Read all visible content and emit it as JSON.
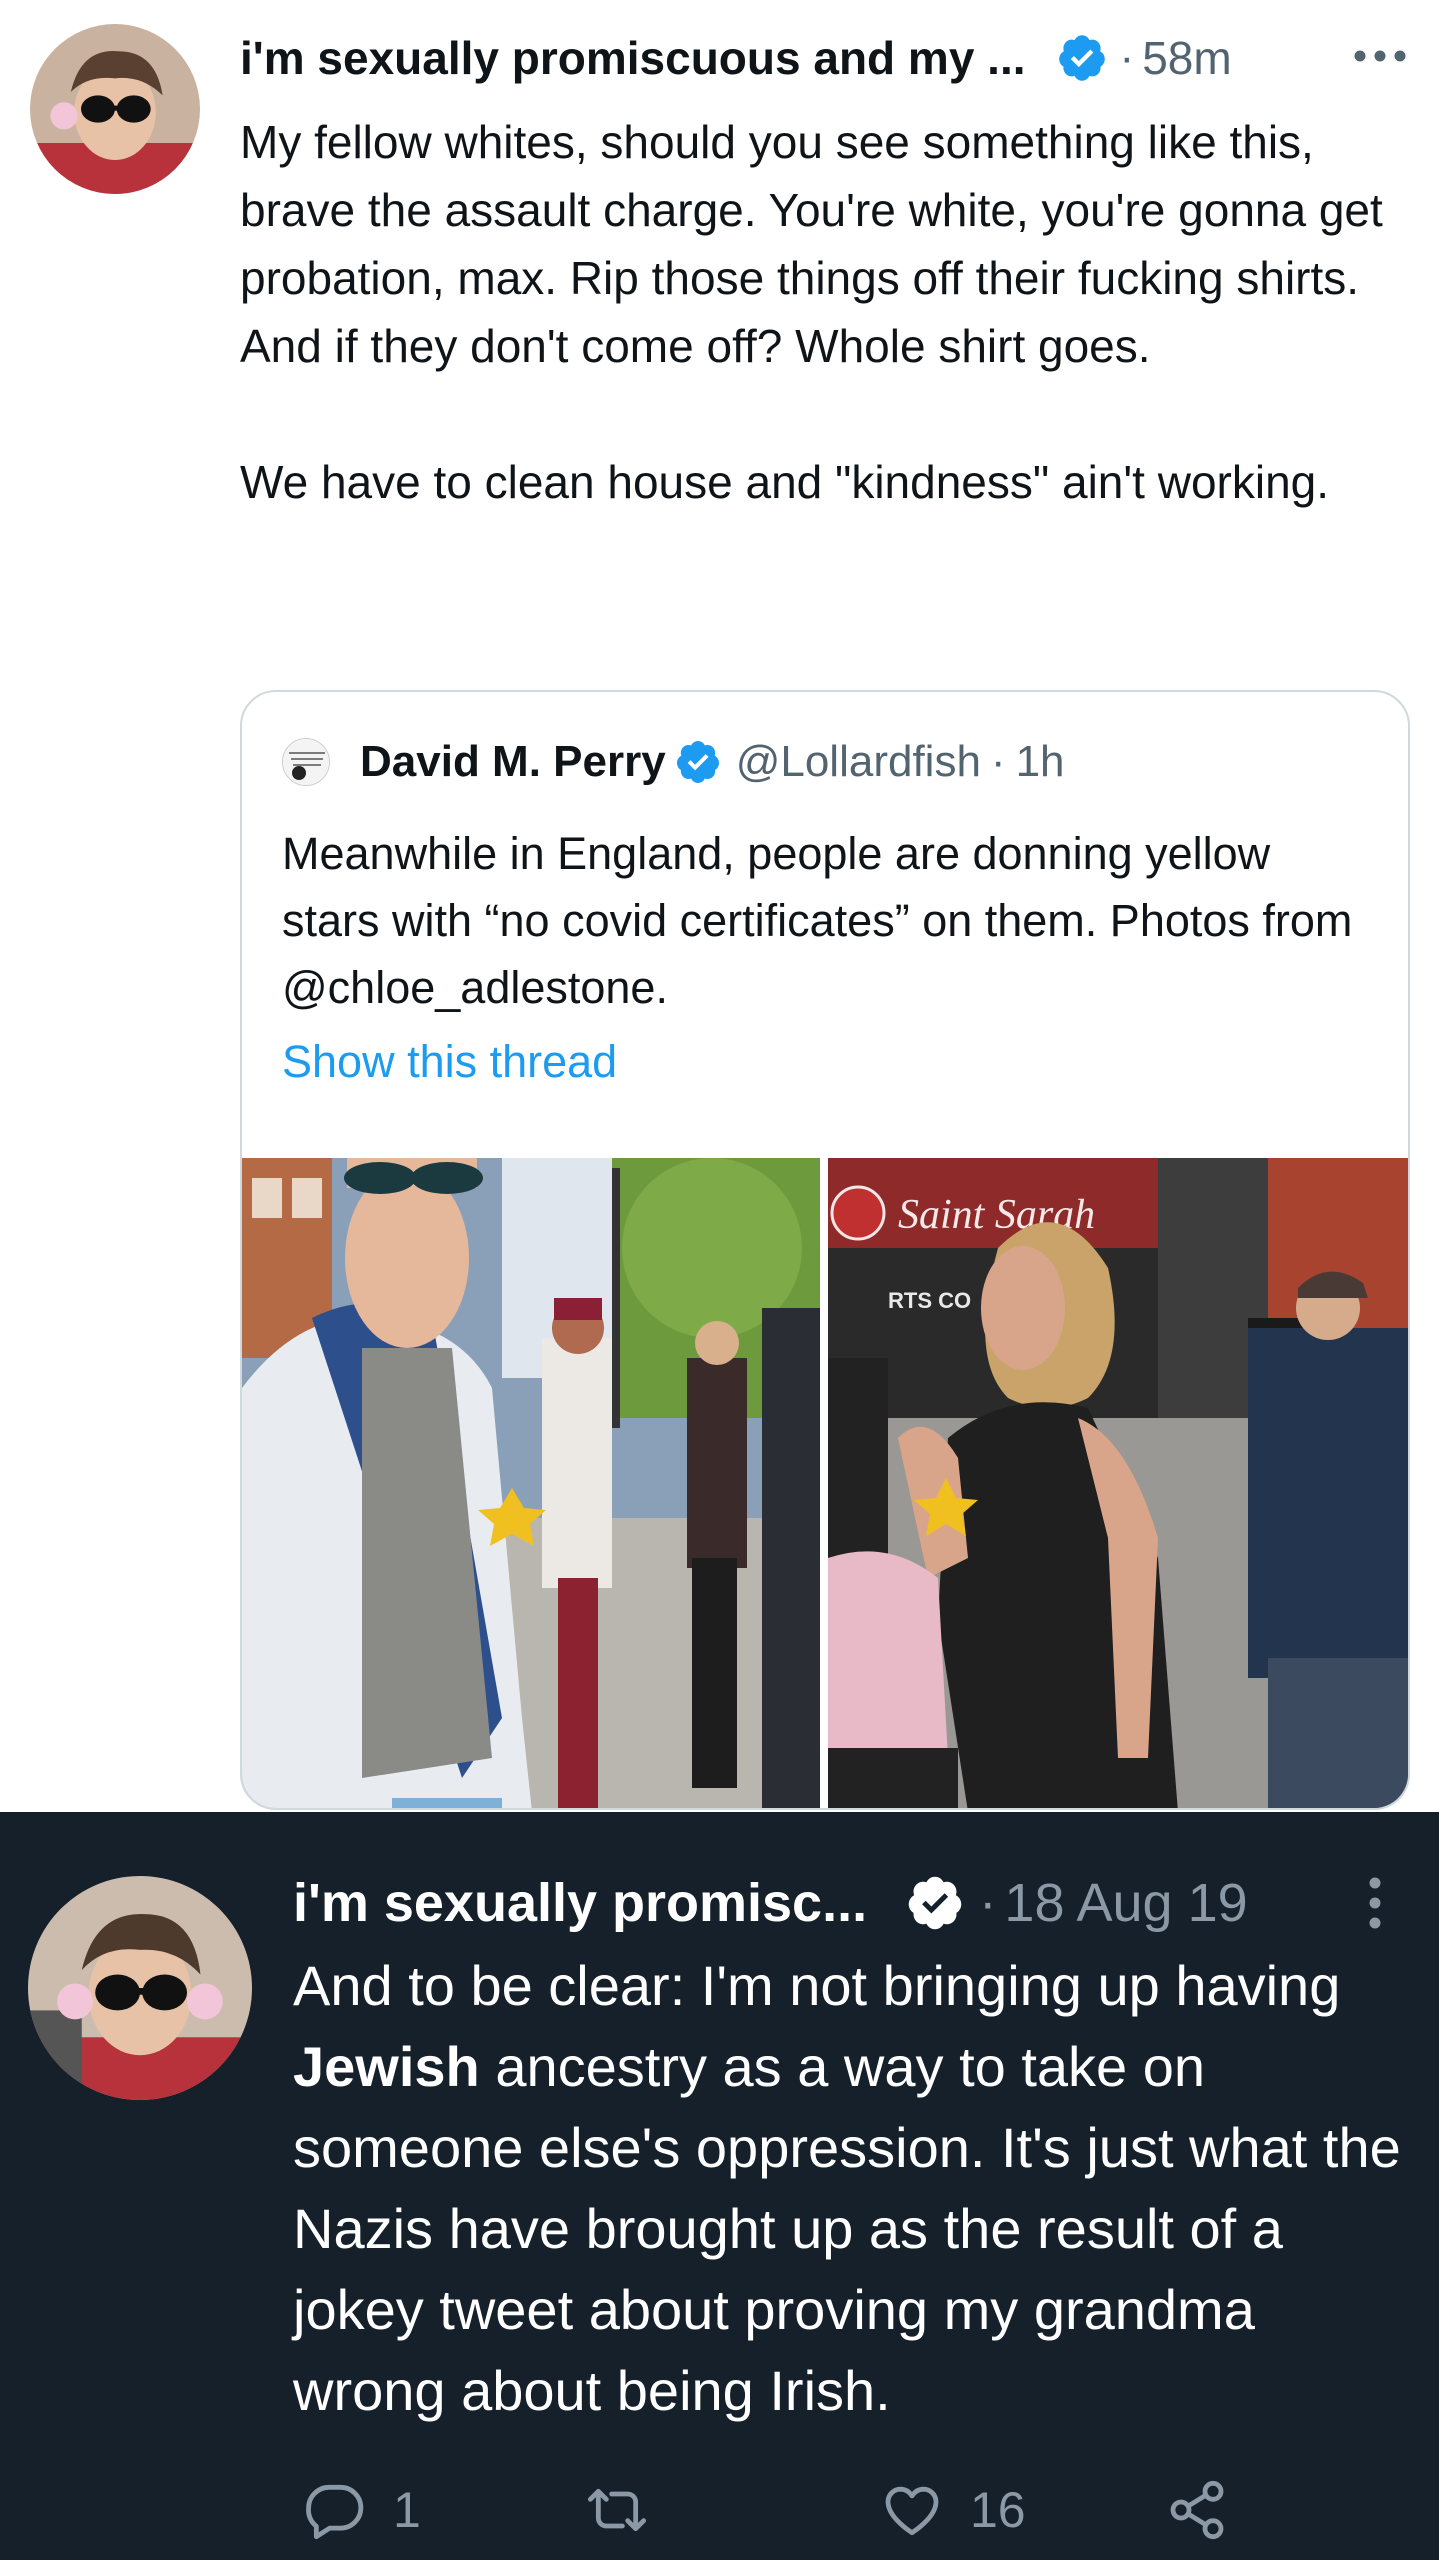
{
  "tweet1": {
    "display_name": "i'm sexually promiscuous and my ...",
    "time": "58m",
    "separator": "·",
    "body_paragraphs": [
      "My fellow whites, should you see something like this, brave the assault charge. You're white, you're gonna get probation, max. Rip those things off their fucking shirts. And if they don't come off? Whole shirt goes.",
      "We have to clean house and \"kindness\" ain't working."
    ],
    "quoted": {
      "display_name": "David M. Perry",
      "handle": "@Lollardfish",
      "time": "1h",
      "separator": "·",
      "body": "Meanwhile in England, people are donning yellow stars with “no covid certificates” on them. Photos from @chloe_adlestone.",
      "show_thread": "Show this thread",
      "photo_sign_text": "Saint Sarah",
      "photo_shop_text": "RTS CO"
    }
  },
  "tweet2": {
    "display_name": "i'm sexually promisc...",
    "time": "18 Aug 19",
    "separator": "·",
    "body_before": "And to be clear: I'm not bringing up having ",
    "body_bold": "Jewish",
    "body_after": " ancestry as a way to take on someone else's oppression. It's just what the Nazis have brought up as the result of a jokey tweet about proving my grandma wrong about being Irish.",
    "reply_count": "1",
    "like_count": "16"
  },
  "colors": {
    "verified_blue": "#1d9bf0",
    "dark_bg": "#15202b",
    "secondary_text_light": "#536471",
    "secondary_text_dark": "#8b98a5"
  },
  "icons": [
    "verified-badge-icon",
    "more-icon",
    "reply-icon",
    "retweet-icon",
    "like-icon",
    "share-icon"
  ]
}
